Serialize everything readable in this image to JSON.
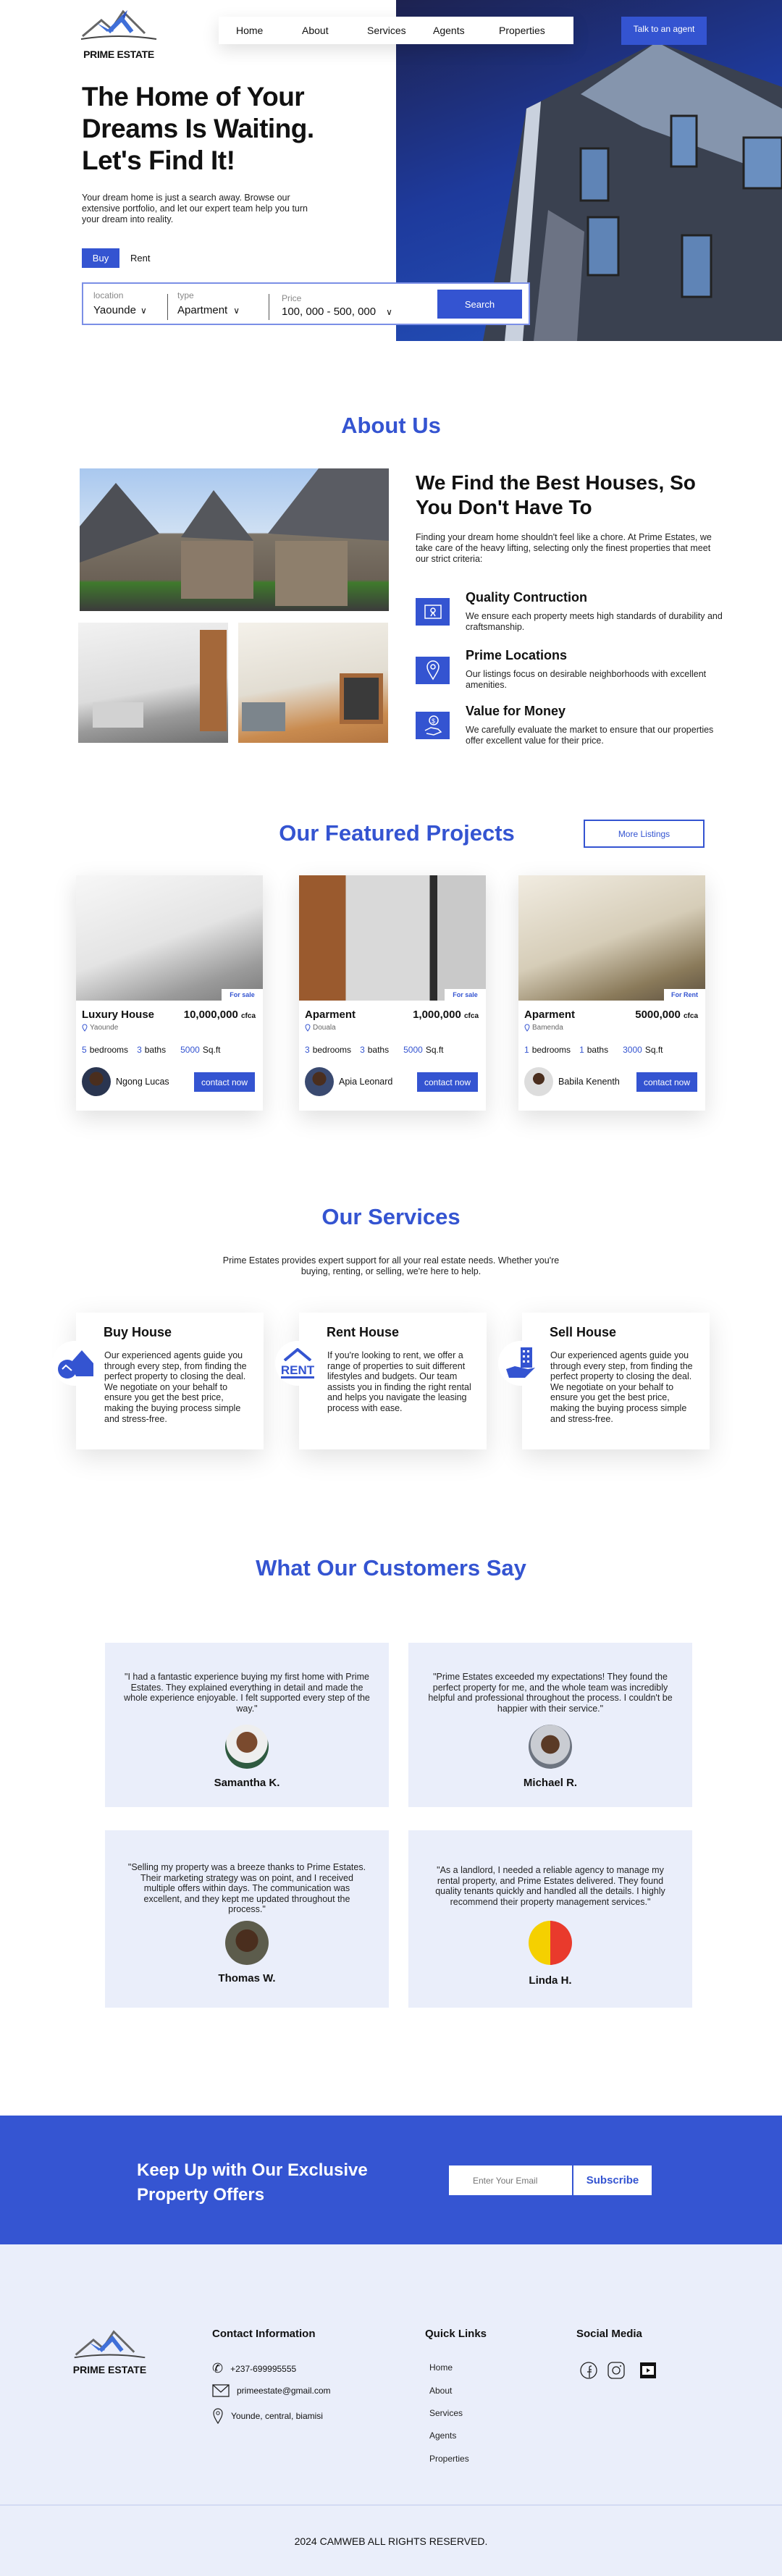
{
  "brand": {
    "name": "PRIME ESTATE",
    "accent": "#3454d1",
    "light_bg": "#eaeefa"
  },
  "nav": {
    "items": [
      "Home",
      "About",
      "Services",
      "Agents",
      "Properties"
    ],
    "cta": "Talk to an agent"
  },
  "hero": {
    "heading": [
      "The Home of Your",
      "Dreams Is Waiting.",
      "Let's Find It!"
    ],
    "paragraph": "Your dream home is just a search away. Browse our extensive portfolio, and let our expert team help you turn your dream into reality.",
    "tabs": {
      "buy": "Buy",
      "rent": "Rent",
      "active": "Buy"
    },
    "search": {
      "location_label": "location",
      "location_value": "Yaounde",
      "type_label": "type",
      "type_value": "Apartment",
      "price_label": "Price",
      "price_value": "100, 000 - 500, 000",
      "button": "Search"
    }
  },
  "about": {
    "title": "About Us",
    "heading": "We Find the Best Houses, So You Don't Have To",
    "paragraph": "Finding your dream home shouldn't feel like a chore. At Prime Estates, we take care of the heavy lifting, selecting only the finest properties that meet our strict criteria:",
    "features": [
      {
        "title": "Quality Contruction",
        "desc": "We ensure each property meets high standards of durability and craftsmanship.",
        "icon": "certificate-icon"
      },
      {
        "title": "Prime Locations",
        "desc": "Our listings focus on desirable neighborhoods with excellent amenities.",
        "icon": "location-pin-icon"
      },
      {
        "title": "Value for Money",
        "desc": "We carefully evaluate the market to ensure that our properties offer excellent value for their price.",
        "icon": "money-hand-icon"
      }
    ]
  },
  "featured": {
    "title": "Our Featured Projects",
    "more": "More Listings",
    "cards": [
      {
        "badge": "For sale",
        "title": "Luxury House",
        "price": "10,000,000",
        "currency": "cfca",
        "location": "Yaounde",
        "bedrooms": "5",
        "baths": "3",
        "sqft": "5000",
        "bedrooms_label": "bedrooms",
        "baths_label": "baths",
        "sqft_label": "Sq.ft",
        "agent": "Ngong Lucas",
        "button": "contact now"
      },
      {
        "badge": "For sale",
        "title": "Aparment",
        "price": "1,000,000",
        "currency": "cfca",
        "location": "Douala",
        "bedrooms": "3",
        "baths": "3",
        "sqft": "5000",
        "bedrooms_label": "bedrooms",
        "baths_label": "baths",
        "sqft_label": "Sq.ft",
        "agent": "Apia Leonard",
        "button": "contact now"
      },
      {
        "badge": "For Rent",
        "title": "Aparment",
        "price": "5000,000",
        "currency": "cfca",
        "location": "Bamenda",
        "bedrooms": "1",
        "baths": "1",
        "sqft": "3000",
        "bedrooms_label": "bedrooms",
        "baths_label": "baths",
        "sqft_label": "Sq.ft",
        "agent": "Babila Kenenth",
        "button": "contact now"
      }
    ]
  },
  "services": {
    "title": "Our Services",
    "paragraph": "Prime Estates provides expert support for all your real estate needs. Whether you're buying, renting, or selling, we're here to help.",
    "cards": [
      {
        "title": "Buy House",
        "desc": "Our experienced agents guide you through every step, from finding the perfect property to closing the deal. We negotiate on your behalf to ensure you get the best price, making the buying process simple and stress-free.",
        "icon": "house-handshake-icon"
      },
      {
        "title": "Rent House",
        "desc": "If you're looking to rent, we offer a range of properties to suit different lifestyles and budgets. Our team assists you in finding the right rental and helps you navigate the leasing process with ease.",
        "icon": "rent-sign-icon",
        "icon_text": "RENT"
      },
      {
        "title": "Sell House",
        "desc": "Our experienced agents guide you through every step, from finding the perfect property to closing the deal. We negotiate on your behalf to ensure you get the best price, making the buying process simple and stress-free.",
        "icon": "building-hand-icon"
      }
    ]
  },
  "testimonials": {
    "title": "What Our Customers Say",
    "items": [
      {
        "quote": "\"I had a fantastic experience buying my first home with Prime Estates. They explained everything in detail and made the whole experience enjoyable. I felt supported every step of the way.\"",
        "name": "Samantha K."
      },
      {
        "quote": "\"Prime Estates exceeded my expectations! They found the perfect property for me, and the whole team was incredibly helpful and professional throughout the process. I couldn't be happier with their service.\"",
        "name": "Michael R."
      },
      {
        "quote": "\"Selling my property was a breeze thanks to Prime Estates. Their marketing strategy was on point, and I received multiple offers within days. The communication was excellent, and they kept me updated throughout the process.\"",
        "name": "Thomas W."
      },
      {
        "quote": "\"As a landlord, I needed a reliable agency to manage my rental property, and Prime Estates delivered. They found quality tenants quickly and handled all the details. I highly recommend their property management services.\"",
        "name": "Linda H."
      }
    ]
  },
  "newsletter": {
    "heading": "Keep Up with Our Exclusive Property Offers",
    "placeholder": "Enter Your Email",
    "button": "Subscribe"
  },
  "footer": {
    "contact_title": "Contact Information",
    "phone": "+237-699995555",
    "email": "primeestate@gmail.com",
    "address": "Younde, central, biamisi",
    "links_title": "Quick Links",
    "links": [
      "Home",
      "About",
      "Services",
      "Agents",
      "Properties"
    ],
    "social_title": "Social Media",
    "social": [
      "facebook-icon",
      "instagram-icon",
      "youtube-icon"
    ],
    "copyright": "2024 CAMWEB ALL RIGHTS RESERVED."
  }
}
